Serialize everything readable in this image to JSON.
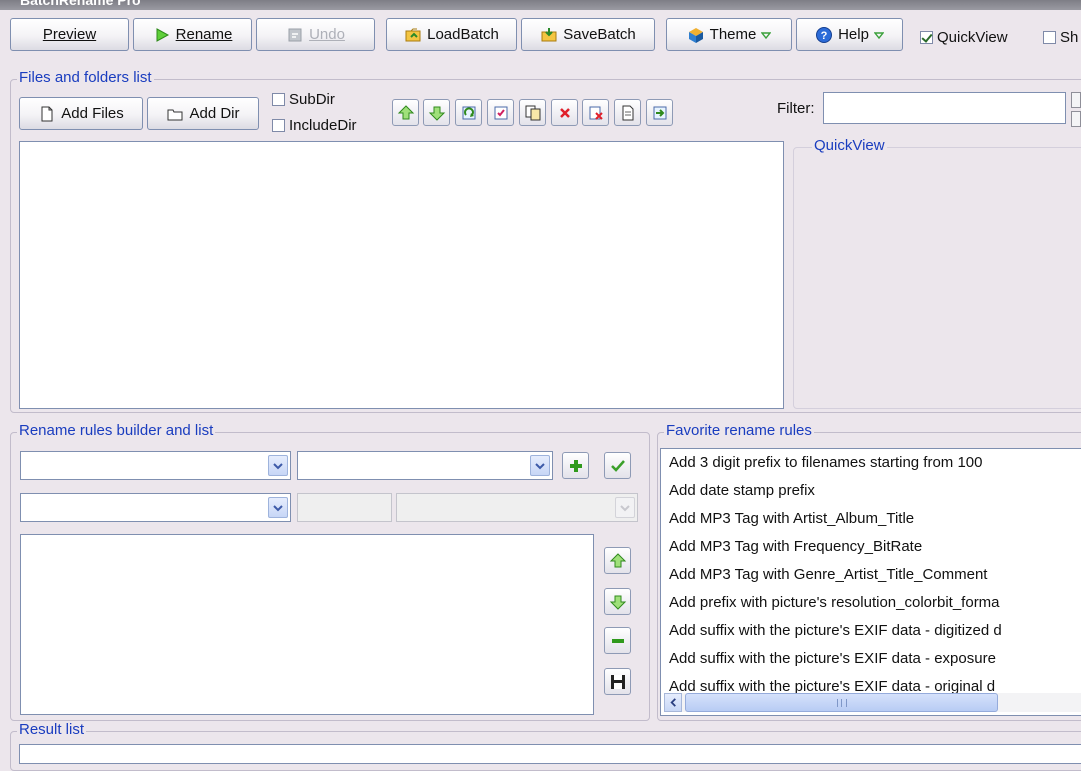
{
  "titlebar": {
    "title": "BatchRename Pro"
  },
  "toolbar": {
    "preview": "Preview",
    "rename": "Rename",
    "undo": "Undo",
    "loadbatch": "LoadBatch",
    "savebatch": "SaveBatch",
    "theme": "Theme",
    "help": "Help",
    "quickview_label": "QuickView",
    "quickview_checked": true,
    "show_label": "Sh",
    "show_checked": false
  },
  "files": {
    "title": "Files and folders list",
    "add_files": "Add Files",
    "add_dir": "Add Dir",
    "subdir": "SubDir",
    "includedir": "IncludeDir",
    "filter_label": "Filter:",
    "filter_value": "",
    "quickview_title": "QuickView"
  },
  "rules": {
    "title": "Rename rules builder and list"
  },
  "favorites": {
    "title": "Favorite rename rules",
    "items": [
      "Add 3 digit prefix to filenames starting from 100",
      "Add date stamp prefix",
      "Add MP3 Tag with Artist_Album_Title",
      "Add MP3 Tag with Frequency_BitRate",
      "Add MP3 Tag with Genre_Artist_Title_Comment",
      "Add prefix with picture's resolution_colorbit_forma",
      "Add suffix with the picture's EXIF data - digitized d",
      "Add suffix with the picture's EXIF data - exposure",
      "Add suffix with the picture's EXIF data - original d"
    ]
  },
  "result": {
    "title": "Result list"
  },
  "colors": {
    "background": "#ece6ec",
    "group_title": "#1a3dbf",
    "border": "#7f8fb0"
  }
}
